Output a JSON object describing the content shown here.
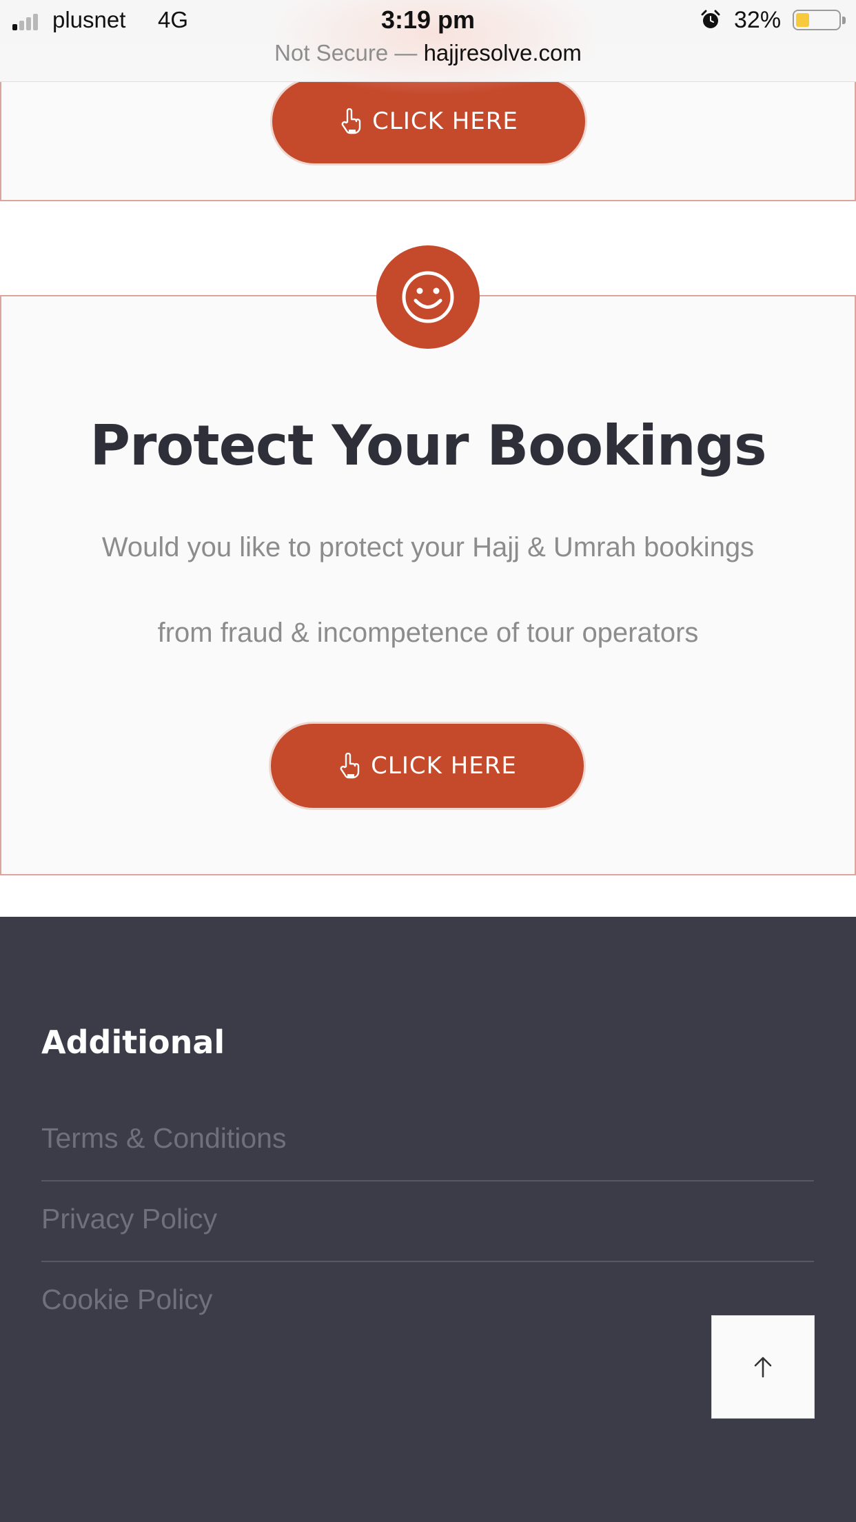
{
  "status_bar": {
    "carrier": "plusnet",
    "network": "4G",
    "time": "3:19 pm",
    "battery_percent": "32%",
    "battery_level": 0.32,
    "signal_bars_active": 1,
    "signal_bars_total": 4
  },
  "url_bar": {
    "security_label": "Not Secure —",
    "host": "hajjresolve.com"
  },
  "top_card": {
    "button_label": "CLICK HERE"
  },
  "main_card": {
    "icon": "smiley-icon",
    "title": "Protect Your Bookings",
    "description_line1": "Would you like to protect your Hajj & Umrah bookings",
    "description_line2": "from fraud & incompetence of tour operators",
    "button_label": "CLICK HERE"
  },
  "footer": {
    "heading": "Additional",
    "links": [
      {
        "label": "Terms & Conditions"
      },
      {
        "label": "Privacy Policy"
      },
      {
        "label": "Cookie Policy"
      }
    ]
  },
  "colors": {
    "accent": "#c5492b",
    "card_border": "#dba59b",
    "footer_bg": "#3b3c48",
    "title_text": "#2e2f39"
  },
  "icons": {
    "button_icon": "hand-pointer-icon",
    "scroll_top_icon": "arrow-up-icon",
    "alarm_icon": "alarm-clock-icon"
  }
}
